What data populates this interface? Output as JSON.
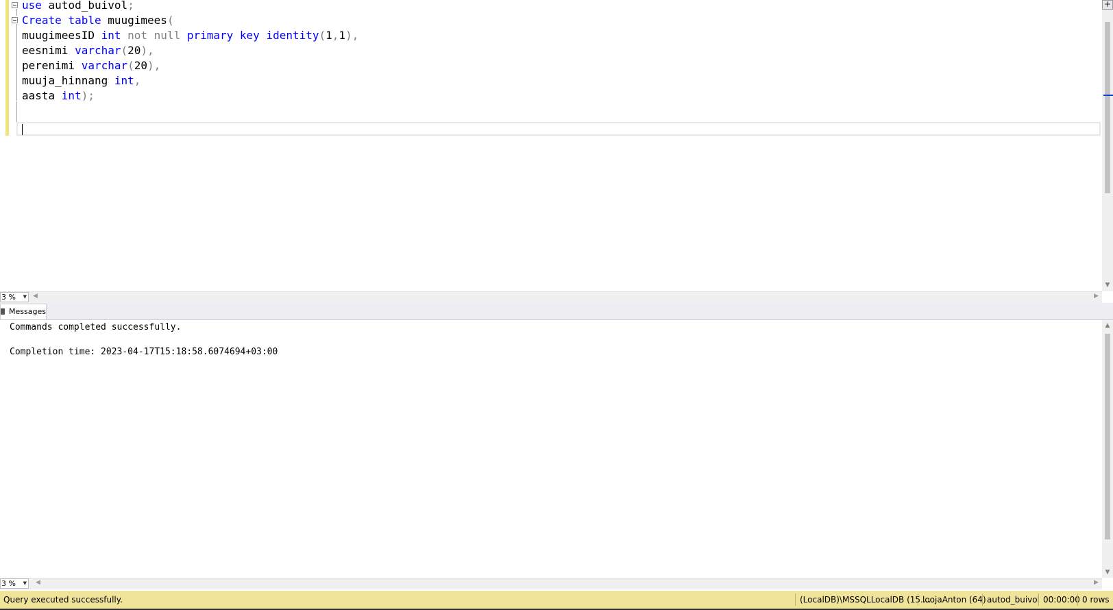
{
  "editor": {
    "lines": [
      [
        {
          "t": "use",
          "c": "kw"
        },
        {
          "t": " autod_buivol",
          "c": ""
        },
        {
          "t": ";",
          "c": "gray"
        }
      ],
      [
        {
          "t": "Create",
          "c": "kw"
        },
        {
          "t": " ",
          "c": ""
        },
        {
          "t": "table",
          "c": "kw"
        },
        {
          "t": " muugimees",
          "c": ""
        },
        {
          "t": "(",
          "c": "gray"
        }
      ],
      [
        {
          "t": "muugimeesID ",
          "c": ""
        },
        {
          "t": "int",
          "c": "kw"
        },
        {
          "t": " ",
          "c": ""
        },
        {
          "t": "not null",
          "c": "gray"
        },
        {
          "t": " ",
          "c": ""
        },
        {
          "t": "primary key identity",
          "c": "kw"
        },
        {
          "t": "(",
          "c": "gray"
        },
        {
          "t": "1",
          "c": ""
        },
        {
          "t": ",",
          "c": "gray"
        },
        {
          "t": "1",
          "c": ""
        },
        {
          "t": "),",
          "c": "gray"
        }
      ],
      [
        {
          "t": "eesnimi ",
          "c": ""
        },
        {
          "t": "varchar",
          "c": "kw"
        },
        {
          "t": "(",
          "c": "gray"
        },
        {
          "t": "20",
          "c": ""
        },
        {
          "t": "),",
          "c": "gray"
        }
      ],
      [
        {
          "t": "perenimi ",
          "c": ""
        },
        {
          "t": "varchar",
          "c": "kw"
        },
        {
          "t": "(",
          "c": "gray"
        },
        {
          "t": "20",
          "c": ""
        },
        {
          "t": "),",
          "c": "gray"
        }
      ],
      [
        {
          "t": "muuja_hinnang ",
          "c": ""
        },
        {
          "t": "int",
          "c": "kw"
        },
        {
          "t": ",",
          "c": "gray"
        }
      ],
      [
        {
          "t": "aasta ",
          "c": ""
        },
        {
          "t": "int",
          "c": "kw"
        },
        {
          "t": ");",
          "c": "gray"
        }
      ]
    ],
    "zoom_label": "3 %"
  },
  "results": {
    "tab_label": "Messages",
    "messages": [
      "Commands completed successfully.",
      "",
      "Completion time: 2023-04-17T15:18:58.6074694+03:00"
    ],
    "zoom_label": "3 %"
  },
  "status_bar": {
    "message": "Query executed successfully.",
    "server": "(LocalDB)\\MSSQLLocalDB (15....",
    "user": "loojaAnton (64)",
    "database": "autod_buivol",
    "elapsed": "00:00:00",
    "rows": "0 rows"
  },
  "colors": {
    "keyword": "#0000ff",
    "punctuation": "#808080",
    "status_bar_bg": "#efe49a",
    "margin_marker": "#f2e27a"
  }
}
